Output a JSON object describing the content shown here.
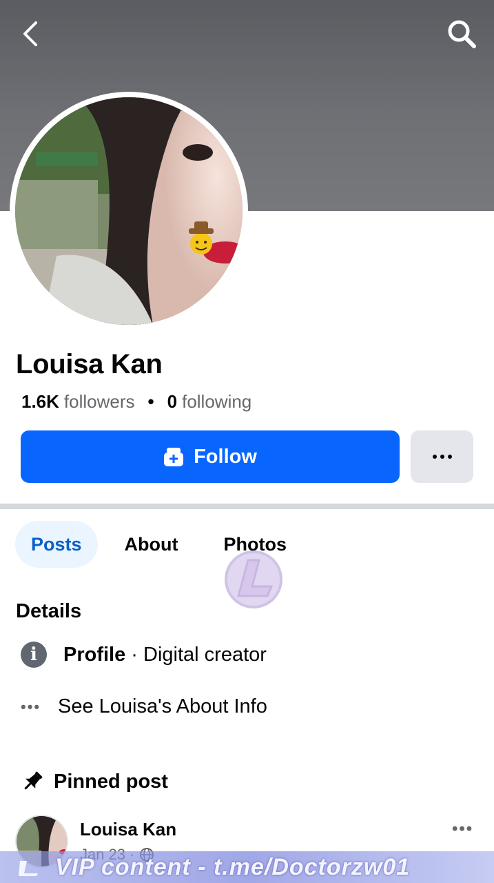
{
  "profile": {
    "name": "Louisa Kan",
    "followers_count": "1.6K",
    "followers_label": "followers",
    "stats_separator": "•",
    "following_count": "0",
    "following_label": "following"
  },
  "actions": {
    "follow_label": "Follow",
    "more_label": "···"
  },
  "tabs": [
    {
      "label": "Posts",
      "active": true
    },
    {
      "label": "About",
      "active": false
    },
    {
      "label": "Photos",
      "active": false
    }
  ],
  "details": {
    "title": "Details",
    "profile_key": "Profile",
    "profile_value": " · Digital creator",
    "about_link": "See Louisa's About Info"
  },
  "pinned": {
    "title": "Pinned post",
    "author": "Louisa Kan",
    "date": "Jan 23 ·"
  },
  "watermark": {
    "text": "VIP content - t.me/Doctorzw01"
  },
  "icons": {
    "back": "chevron-left-icon",
    "search": "search-icon",
    "follow": "follow-icon",
    "info": "info-icon",
    "dots": "more-dots-icon",
    "pin": "pin-icon",
    "globe": "globe-icon",
    "emoji": "cowboy-emoji"
  },
  "colors": {
    "accent": "#0866ff",
    "tab_active_bg": "#ebf5ff",
    "tab_active_text": "#0a60c9",
    "secondary_text": "#65676b"
  }
}
